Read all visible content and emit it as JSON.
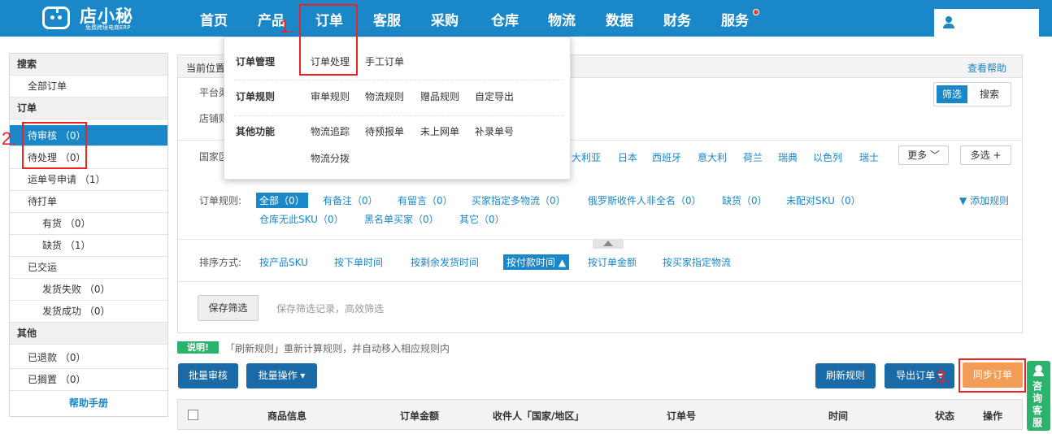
{
  "brand": {
    "name": "店小秘",
    "tagline": "免费跨境电商ERP"
  },
  "nav": {
    "items": [
      "首页",
      "产品",
      "订单",
      "客服",
      "采购",
      "仓库",
      "物流",
      "数据",
      "财务",
      "服务"
    ]
  },
  "sidebar": {
    "sections": [
      {
        "head": "搜索",
        "items": [
          {
            "label": "全部订单",
            "count": ""
          }
        ]
      },
      {
        "head": "订单",
        "items": [
          {
            "label": "待审核",
            "count": "（0）"
          },
          {
            "label": "待处理",
            "count": "（0）"
          },
          {
            "label": "运单号申请",
            "count": "（1）"
          },
          {
            "label": "待打单",
            "count": ""
          },
          {
            "label": "有货",
            "count": "（0）"
          },
          {
            "label": "缺货",
            "count": "（1）"
          },
          {
            "label": "已交运",
            "count": ""
          },
          {
            "label": "发货失败",
            "count": "（0）"
          },
          {
            "label": "发货成功",
            "count": "（0）"
          }
        ]
      },
      {
        "head": "其他",
        "items": [
          {
            "label": "已退款",
            "count": "（0）"
          },
          {
            "label": "已搁置",
            "count": "（0）"
          }
        ]
      }
    ],
    "help": "帮助手册"
  },
  "panel": {
    "crumb": "当前位置",
    "help": "查看帮助",
    "platform_label": "平台渠",
    "store_label": "店铺则",
    "country_label": "国家区",
    "mode_filter": "筛选",
    "mode_search": "搜索",
    "countries": [
      "大利亚",
      "日本",
      "西班牙",
      "意大利",
      "荷兰",
      "瑞典",
      "以色列",
      "瑞士"
    ],
    "more": "更多",
    "multi": "多选 +",
    "rules_label": "订单规则:",
    "rules": [
      {
        "label": "全部（0）",
        "selected": true
      },
      {
        "label": "有备注（0）"
      },
      {
        "label": "有留言（0）"
      },
      {
        "label": "买家指定多物流（0）"
      },
      {
        "label": "俄罗斯收件人非全名（0）"
      },
      {
        "label": "缺货（0）"
      },
      {
        "label": "未配对SKU（0）"
      },
      {
        "label": "仓库无此SKU（0）"
      },
      {
        "label": "黑名单买家（0）"
      },
      {
        "label": "其它（0）"
      }
    ],
    "add_rule": "添加规则",
    "sort_label": "排序方式:",
    "sorts": [
      "按产品SKU",
      "按下单时间",
      "按剩余发货时间",
      "按付款时间",
      "按订单金额",
      "按买家指定物流"
    ],
    "save_filter": "保存筛选",
    "save_hint": "保存筛选记录，高效筛选"
  },
  "dropdown": {
    "groups": [
      {
        "head": "订单管理",
        "items": [
          "订单处理",
          "手工订单"
        ]
      },
      {
        "head": "订单规则",
        "items": [
          "审单规则",
          "物流规则",
          "赠品规则",
          "自定导出"
        ]
      },
      {
        "head": "其他功能",
        "items": [
          "物流追踪",
          "待预报单",
          "未上网单",
          "补录单号",
          "物流分拨"
        ]
      }
    ]
  },
  "notice": {
    "tag": "说明!",
    "text": "「刷新规则」重新计算规则，并自动移入相应规则内"
  },
  "actions": {
    "bulk_audit": "批量审核",
    "bulk_ops": "批量操作",
    "refresh_rules": "刷新规则",
    "export": "导出订单",
    "sync": "同步订单"
  },
  "table": {
    "headers": [
      "商品信息",
      "订单金额",
      "收件人「国家/地区」",
      "订单号",
      "时间",
      "状态",
      "操作"
    ]
  },
  "consult": "咨询客服",
  "annotations": [
    "1.",
    "2.",
    "3."
  ],
  "colors": {
    "primary": "#1a87c9",
    "accent_orange": "#f39c55",
    "annotation_red": "#e22",
    "notice_green": "#2bb26b"
  }
}
